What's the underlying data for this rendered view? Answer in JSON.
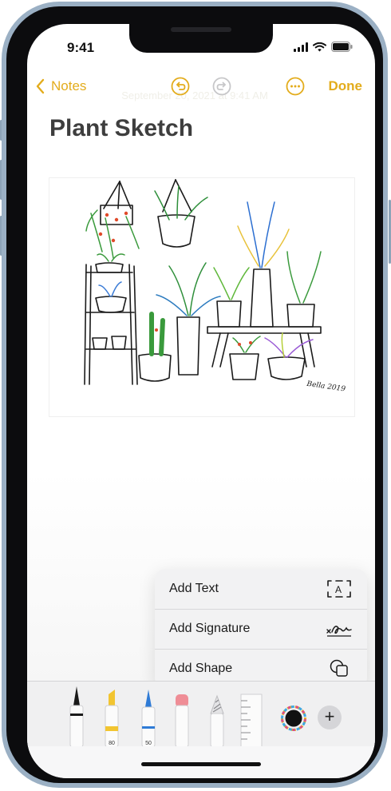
{
  "status_bar": {
    "time": "9:41"
  },
  "nav": {
    "back_label": "Notes",
    "date_text": "September 20, 2021 at 9:41 AM",
    "done_label": "Done"
  },
  "note": {
    "title": "Plant Sketch",
    "signature": "Bella 2019"
  },
  "popover": {
    "items": [
      {
        "label": "Add Text",
        "icon": "text-box-icon"
      },
      {
        "label": "Add Signature",
        "icon": "signature-icon"
      },
      {
        "label": "Add Shape",
        "icon": "shapes-icon"
      }
    ]
  },
  "toolbar": {
    "tools": [
      {
        "name": "pen",
        "label": ""
      },
      {
        "name": "marker",
        "label": "80",
        "color": "#f2c531"
      },
      {
        "name": "pencil",
        "label": "50",
        "color": "#2f7bd6"
      },
      {
        "name": "eraser",
        "label": ""
      },
      {
        "name": "lasso",
        "label": ""
      },
      {
        "name": "ruler",
        "label": ""
      }
    ],
    "plus_label": "+"
  },
  "colors": {
    "accent": "#e3ac1c",
    "frame": "#9bb0c4"
  }
}
